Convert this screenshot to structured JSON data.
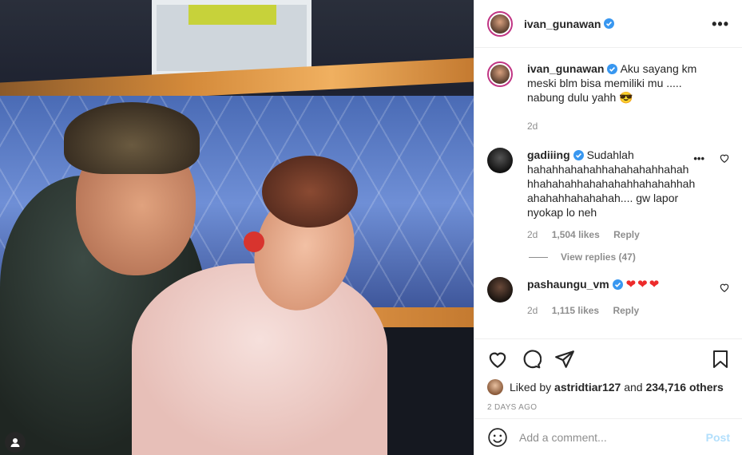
{
  "post": {
    "author": "ivan_gunawan",
    "caption": {
      "username": "ivan_gunawan",
      "text_lines": [
        "Aku sayang km",
        "meski blm bisa memiliki mu .....",
        "nabung dulu yahh 😎"
      ],
      "age": "2d"
    },
    "comments": [
      {
        "username": "gadiiing",
        "text_lines": [
          "Sudahlah",
          "hahahhahahahhahahahahhahah",
          "hhahahahhahahahahhahahahhah",
          "ahahahhahahahah.... gw lapor",
          "nyokap lo neh"
        ],
        "age": "2d",
        "likes": "1,504 likes",
        "reply": "Reply",
        "view_replies": "View replies (47)"
      },
      {
        "username": "pashaungu_vm",
        "text": "❤❤❤",
        "age": "2d",
        "likes": "1,115 likes",
        "reply": "Reply"
      }
    ],
    "liked_by": {
      "prefix": "Liked by",
      "user": "astridtiar127",
      "middle": "and",
      "others": "234,716 others"
    },
    "time_ago": "2 DAYS AGO",
    "add_comment": {
      "placeholder": "Add a comment...",
      "post_label": "Post"
    }
  },
  "icons": {
    "verified": "verified-badge-icon",
    "more": "more-options-icon",
    "like": "heart-icon",
    "comment": "comment-icon",
    "share": "share-icon",
    "save": "bookmark-icon",
    "emoji": "emoji-icon",
    "user_tag": "user-tag-icon"
  },
  "colors": {
    "verified": "#3897f0",
    "hearts": "#ed2b2b",
    "post_disabled": "#b2dffc",
    "secondary_text": "#8e8e8e"
  }
}
